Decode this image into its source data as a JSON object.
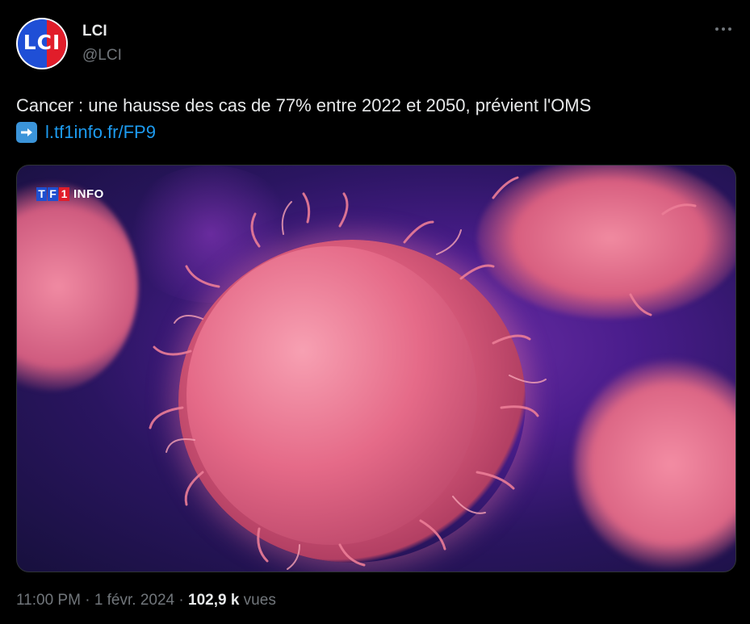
{
  "account": {
    "name": "LCI",
    "handle": "@LCI",
    "avatar_text": "LCI"
  },
  "tweet": {
    "text": "Cancer : une hausse des cas de 77% entre 2022 et 2050, prévient l'OMS",
    "link_text": "l.tf1info.fr/FP9",
    "arrow_icon": "right-arrow-emoji-icon"
  },
  "media": {
    "badge_letters": [
      "T",
      "F",
      "1",
      ""
    ],
    "badge_label": "INFO"
  },
  "meta": {
    "time": "11:00 PM",
    "separator1": " · ",
    "date": "1 févr. 2024",
    "separator2": " · ",
    "views_count": "102,9 k",
    "views_label": " vues"
  },
  "colors": {
    "background": "#000000",
    "text": "#e7e9ea",
    "muted": "#71767b",
    "link": "#1d9bf0",
    "lci_blue": "#1f4fd6",
    "lci_red": "#e11d2a"
  }
}
